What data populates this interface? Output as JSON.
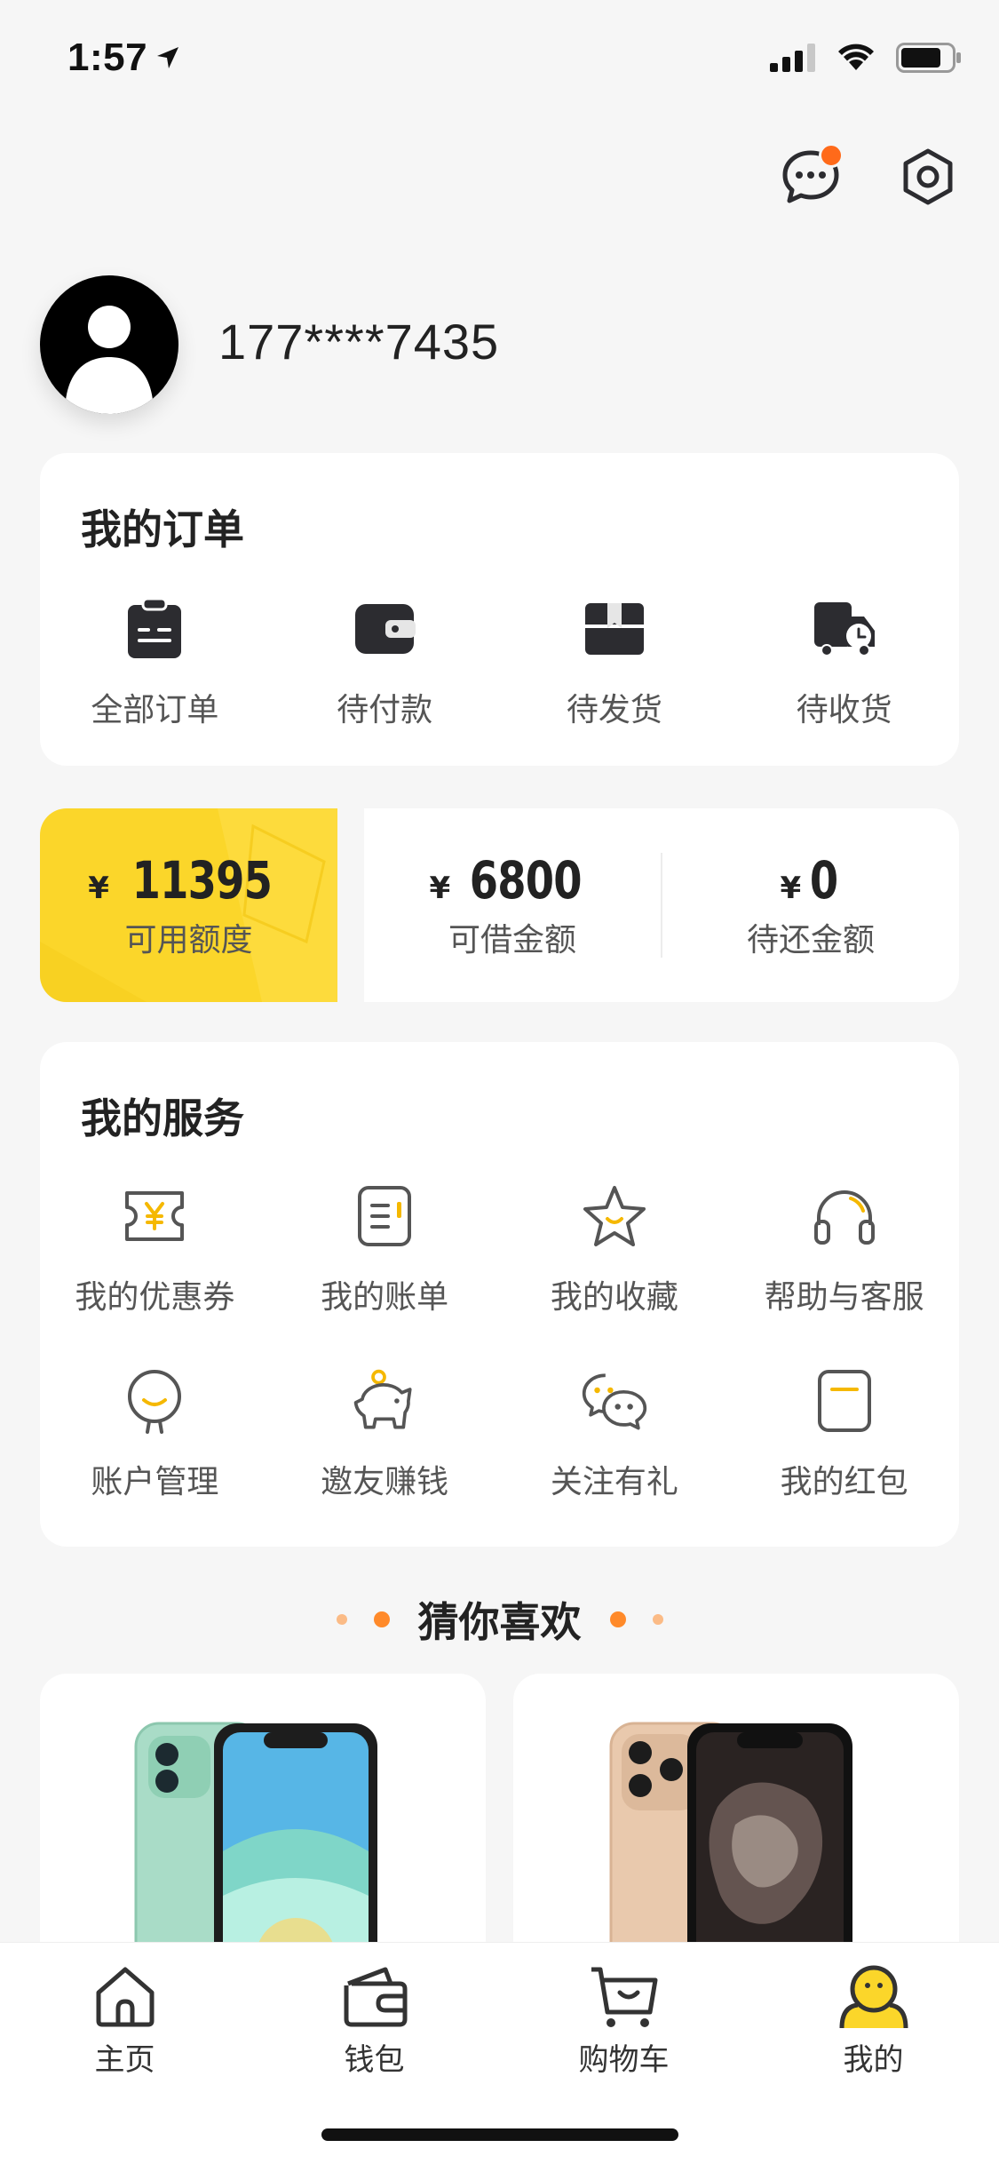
{
  "status_bar": {
    "time": "1:57"
  },
  "profile": {
    "phone": "177****7435"
  },
  "orders": {
    "title": "我的订单",
    "items": [
      {
        "label": "全部订单",
        "icon": "clipboard-icon"
      },
      {
        "label": "待付款",
        "icon": "wallet-icon"
      },
      {
        "label": "待发货",
        "icon": "box-icon"
      },
      {
        "label": "待收货",
        "icon": "truck-icon"
      }
    ]
  },
  "credit": {
    "available": {
      "currency": "¥",
      "value": "11395",
      "label": "可用额度"
    },
    "borrowable": {
      "currency": "¥",
      "value": "6800",
      "label": "可借金额"
    },
    "repay": {
      "currency": "¥",
      "value": "0",
      "label": "待还金额"
    }
  },
  "services": {
    "title": "我的服务",
    "items": [
      {
        "label": "我的优惠券",
        "icon": "coupon-icon"
      },
      {
        "label": "我的账单",
        "icon": "bill-icon"
      },
      {
        "label": "我的收藏",
        "icon": "star-icon"
      },
      {
        "label": "帮助与客服",
        "icon": "headset-icon"
      },
      {
        "label": "账户管理",
        "icon": "account-icon"
      },
      {
        "label": "邀友赚钱",
        "icon": "piggy-bank-icon"
      },
      {
        "label": "关注有礼",
        "icon": "wechat-icon"
      },
      {
        "label": "我的红包",
        "icon": "red-packet-icon"
      }
    ]
  },
  "recommend": {
    "title": "猜你喜欢"
  },
  "tabbar": {
    "items": [
      {
        "label": "主页",
        "icon": "home-icon"
      },
      {
        "label": "钱包",
        "icon": "wallet-icon"
      },
      {
        "label": "购物车",
        "icon": "cart-icon"
      },
      {
        "label": "我的",
        "icon": "profile-icon"
      }
    ]
  },
  "colors": {
    "accent": "#fbd62a",
    "badge": "#ff6a1a",
    "dot": "#ff8a2a",
    "icon_dark": "#2c2c30"
  }
}
